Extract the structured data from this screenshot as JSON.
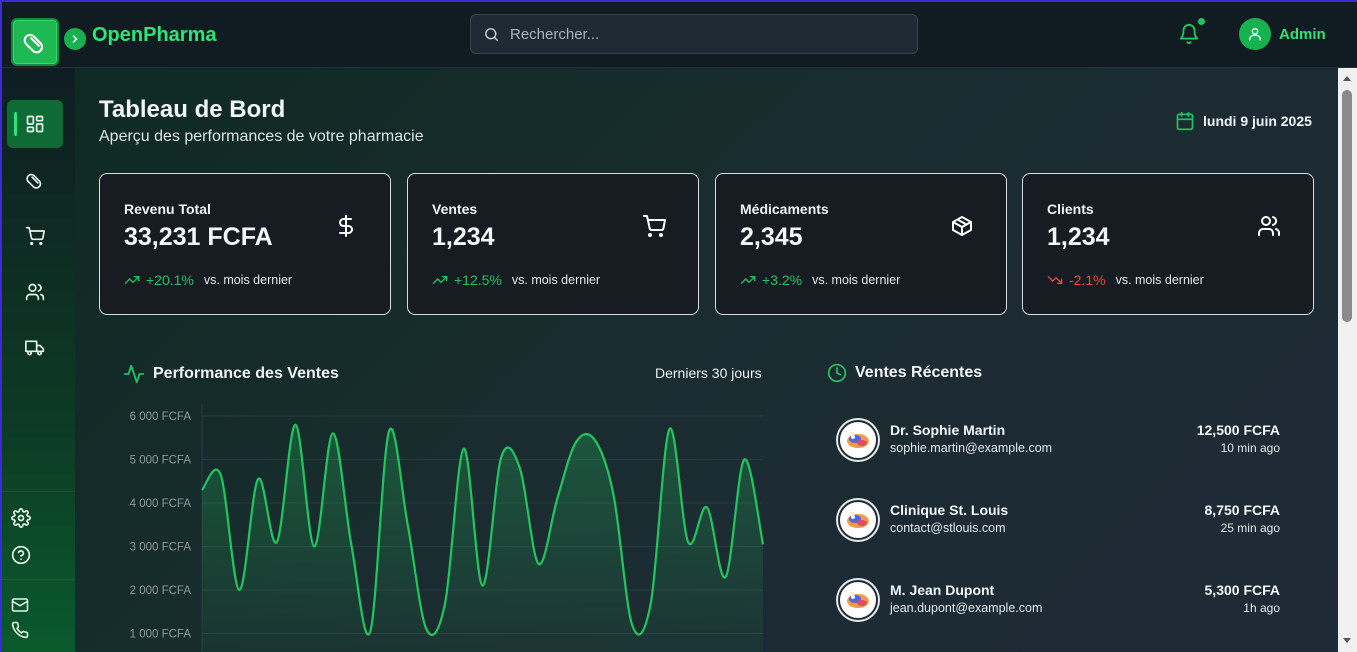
{
  "app": {
    "name": "OpenPharma"
  },
  "search": {
    "placeholder": "Rechercher..."
  },
  "user": {
    "name": "Admin"
  },
  "sidebar": {
    "items": [
      {
        "icon": "dashboard-icon",
        "active": true
      },
      {
        "icon": "pill-icon"
      },
      {
        "icon": "cart-icon"
      },
      {
        "icon": "users-icon"
      },
      {
        "icon": "truck-icon"
      }
    ],
    "bottom": [
      "settings-icon",
      "help-icon"
    ],
    "contact": [
      "mail-icon",
      "phone-icon"
    ]
  },
  "header": {
    "title": "Tableau de Bord",
    "subtitle": "Aperçu des performances de votre pharmacie",
    "date": "lundi 9 juin 2025"
  },
  "stats": [
    {
      "label": "Revenu Total",
      "value": "33,231 FCFA",
      "trend": "+20.1%",
      "direction": "up",
      "note": "vs. mois dernier",
      "icon": "dollar-icon"
    },
    {
      "label": "Ventes",
      "value": "1,234",
      "trend": "+12.5%",
      "direction": "up",
      "note": "vs. mois dernier",
      "icon": "cart-icon"
    },
    {
      "label": "Médicaments",
      "value": "2,345",
      "trend": "+3.2%",
      "direction": "up",
      "note": "vs. mois dernier",
      "icon": "box-icon"
    },
    {
      "label": "Clients",
      "value": "1,234",
      "trend": "-2.1%",
      "direction": "down",
      "note": "vs. mois dernier",
      "icon": "users-icon"
    }
  ],
  "performance": {
    "title": "Performance des Ventes",
    "range": "Derniers 30 jours"
  },
  "chart_data": {
    "type": "area",
    "y_ticks": [
      "6 000 FCFA",
      "5 000 FCFA",
      "4 000 FCFA",
      "3 000 FCFA",
      "2 000 FCFA",
      "1 000 FCFA"
    ],
    "ylim": [
      800,
      6000
    ],
    "x": [
      0,
      1,
      2,
      3,
      4,
      5,
      6,
      7,
      8,
      9,
      10,
      11,
      12,
      13,
      14,
      15,
      16,
      17,
      18,
      19,
      20,
      21,
      22,
      23,
      24,
      25,
      26,
      27,
      28,
      29,
      30
    ],
    "values": [
      4300,
      4650,
      2000,
      4550,
      3100,
      5800,
      3000,
      5600,
      3000,
      1050,
      5650,
      3500,
      1100,
      1700,
      5250,
      2100,
      5050,
      4800,
      2600,
      4100,
      5400,
      5450,
      4200,
      1200,
      1700,
      5700,
      3100,
      3900,
      2300,
      5000,
      3050
    ],
    "color": "#22c55e"
  },
  "recent": {
    "title": "Ventes Récentes",
    "items": [
      {
        "name": "Dr. Sophie Martin",
        "email": "sophie.martin@example.com",
        "amount": "12,500 FCFA",
        "time": "10 min ago"
      },
      {
        "name": "Clinique St. Louis",
        "email": "contact@stlouis.com",
        "amount": "8,750 FCFA",
        "time": "25 min ago"
      },
      {
        "name": "M. Jean Dupont",
        "email": "jean.dupont@example.com",
        "amount": "5,300 FCFA",
        "time": "1h ago"
      }
    ]
  },
  "colors": {
    "accent": "#22c55e",
    "negative": "#ef4444",
    "card_bg": "#161c22"
  }
}
